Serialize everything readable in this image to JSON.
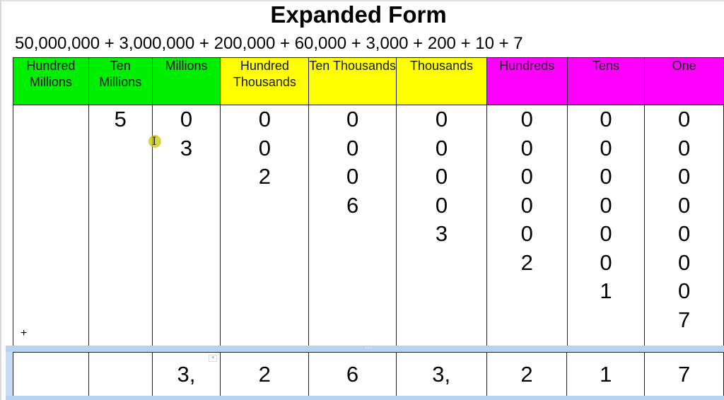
{
  "title": "Expanded Form",
  "equation": "50,000,000 + 3,000,000 + 200,000 + 60,000 + 3,000 + 200 + 10 + 7",
  "colors": {
    "millions_group": "#00ee00",
    "thousands_group": "#ffff00",
    "ones_group": "#ff00ff",
    "selection": "#b8d4f3"
  },
  "columns": [
    {
      "header": "Hundred Millions",
      "group": "millions",
      "digits": [],
      "sum": ""
    },
    {
      "header": "Ten Millions",
      "group": "millions",
      "digits": [
        "5"
      ],
      "sum": ""
    },
    {
      "header": "Millions",
      "group": "millions",
      "digits": [
        "0",
        "3"
      ],
      "sum": "3,"
    },
    {
      "header": "Hundred Thousands",
      "group": "thousands",
      "digits": [
        "0",
        "0",
        "2"
      ],
      "sum": "2"
    },
    {
      "header": "Ten Thousands",
      "group": "thousands",
      "digits": [
        "0",
        "0",
        "0",
        "6"
      ],
      "sum": "6"
    },
    {
      "header": "Thousands",
      "group": "thousands",
      "digits": [
        "0",
        "0",
        "0",
        "0",
        "3"
      ],
      "sum": "3,"
    },
    {
      "header": "Hundreds",
      "group": "ones",
      "digits": [
        "0",
        "0",
        "0",
        "0",
        "0",
        "2"
      ],
      "sum": "2"
    },
    {
      "header": "Tens",
      "group": "ones",
      "digits": [
        "0",
        "0",
        "0",
        "0",
        "0",
        "0",
        "1"
      ],
      "sum": "1"
    },
    {
      "header": "One",
      "group": "ones",
      "digits": [
        "0",
        "0",
        "0",
        "0",
        "0",
        "0",
        "0",
        "7"
      ],
      "sum": "7"
    }
  ],
  "plus_sign": "+",
  "dropdown_arrow": "▾",
  "handle_dots": "⋯",
  "cursor_glyph": "I"
}
